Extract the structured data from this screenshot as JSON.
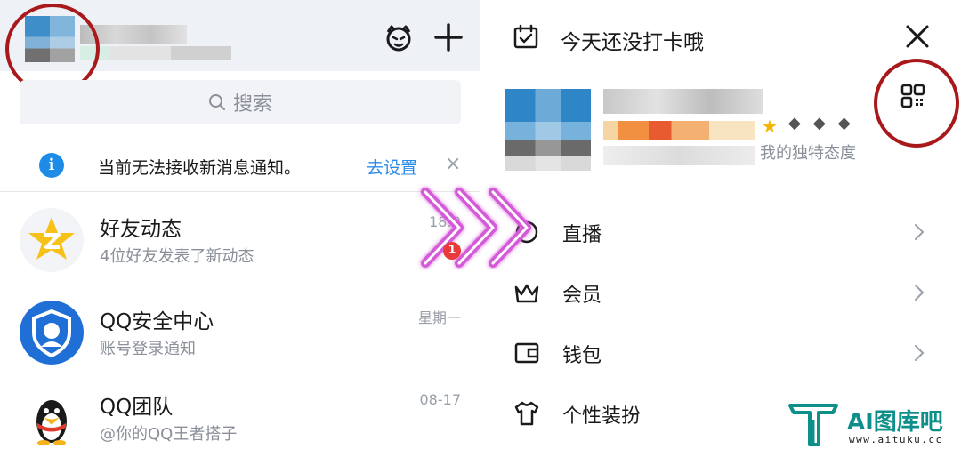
{
  "left": {
    "search_placeholder": "搜索",
    "notice": {
      "text": "当前无法接收新消息通知。",
      "action": "去设置",
      "close": "×"
    },
    "chats": [
      {
        "title": "好友动态",
        "subtitle": "4位好友发表了新动态",
        "time": "18:2"
      },
      {
        "title": "QQ安全中心",
        "subtitle": "账号登录通知",
        "time": "星期一"
      },
      {
        "title": "QQ团队",
        "subtitle": "@你的QQ王者搭子",
        "time": "08-17"
      }
    ],
    "unread_badge": "1"
  },
  "right": {
    "checkin_text": "今天还没打卡哦",
    "signature": "我的独特态度",
    "menu": [
      {
        "label": "直播",
        "icon": "live-icon"
      },
      {
        "label": "会员",
        "icon": "crown-icon"
      },
      {
        "label": "钱包",
        "icon": "wallet-icon"
      },
      {
        "label": "个性装扮",
        "icon": "shirt-icon"
      }
    ]
  },
  "watermark": {
    "name": "AI图库吧",
    "url": "www.aituku.cc"
  },
  "colors": {
    "accent_blue": "#2a8ce8",
    "highlight_red": "#a8191c",
    "arrow_pink": "#d45ad8",
    "logo_teal": "#0f8f8a"
  }
}
